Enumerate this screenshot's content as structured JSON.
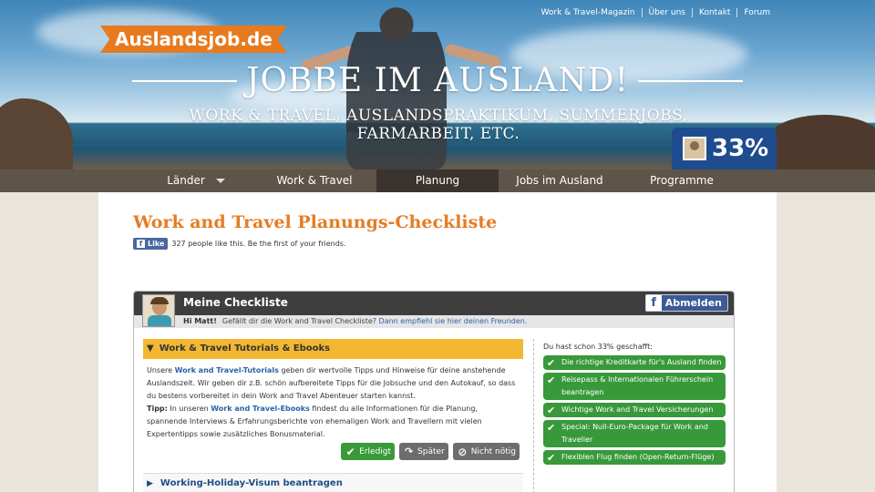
{
  "header": {
    "logo": "Auslandsjob.de",
    "top_links": [
      "Work & Travel-Magazin",
      "Über uns",
      "Kontakt",
      "Forum"
    ],
    "headline": "JOBBE IM AUSLAND!",
    "subline": "WORK & TRAVEL, AUSLANDSPRAKTIKUM, SUMMERJOBS, FARMARBEIT, ETC.",
    "progress_badge": "33%"
  },
  "nav": {
    "items": [
      {
        "label": "Länder"
      },
      {
        "label": "Work & Travel"
      },
      {
        "label": "Planung"
      },
      {
        "label": "Jobs im Ausland"
      },
      {
        "label": "Programme"
      }
    ],
    "active": "Planung"
  },
  "main": {
    "title": "Work and Travel Planungs-Checkliste",
    "fb_like": {
      "button": "Like",
      "text": "327 people like this. Be the first of your friends."
    }
  },
  "checklist": {
    "title": "Meine Checkliste",
    "logout_label": "Abmelden",
    "greeting_name": "Hi Matt!",
    "greeting_text": "Gefällt dir die Work and Travel Checkliste?",
    "greeting_link": "Dann empfiehl sie hier deinen Freunden.",
    "open_section": {
      "title": "Work & Travel Tutorials & Ebooks",
      "p1_a": "Unsere ",
      "p1_link": "Work and Travel-Tutorials",
      "p1_b": " geben dir wertvolle Tipps und Hinweise für deine anstehende Auslandszeit. Wir geben dir z.B. schön aufbereitete Tipps für die Jobsuche und den Autokauf, so dass du bestens vorbereitet in dein Work and Travel Abenteuer starten kannst.",
      "tip_label": "Tipp:",
      "p2_a": " In unseren ",
      "p2_link": "Work and Travel-Ebooks",
      "p2_b": " findest du alle Informationen für die Planung, spannende Interviews & Erfahrungsberichte von ehemaligen Work and Travellern mit vielen Expertentipps sowie zusätzliches Bonusmaterial.",
      "buttons": {
        "done": "Erledigt",
        "later": "Später",
        "not_needed": "Nicht nötig"
      }
    },
    "closed_section": {
      "title": "Working-Holiday-Visum beantragen"
    },
    "done_text": "Du hast schon 33% geschafft:",
    "done_items": [
      "Die richtige Kreditkarte für's Ausland finden",
      "Reisepass & Internationalen Führerschein beantragen",
      "Wichtige Work and Travel Versicherungen",
      "Special: Null-Euro-Package für Work and Traveller",
      "Flexiblen Flug finden (Open-Return-Flüge)"
    ]
  },
  "colors": {
    "accent_orange": "#e47d24",
    "nav_bg": "#5e544a",
    "progress_blue": "#1e4c8f",
    "done_green": "#38993a",
    "section_yellow": "#f3b731"
  }
}
